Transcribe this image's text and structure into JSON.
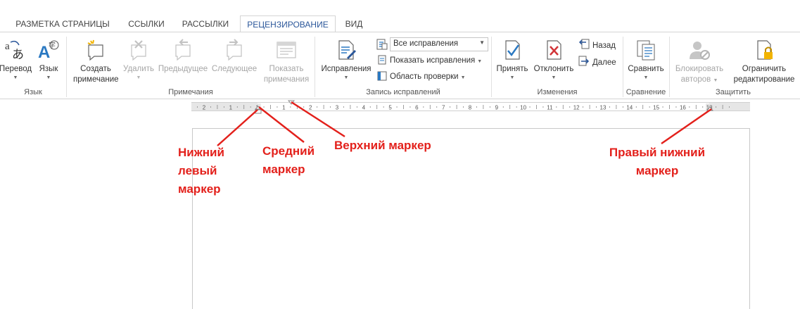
{
  "tabs": [
    {
      "label": "РАЗМЕТКА СТРАНИЦЫ",
      "active": false
    },
    {
      "label": "ССЫЛКИ",
      "active": false
    },
    {
      "label": "РАССЫЛКИ",
      "active": false
    },
    {
      "label": "РЕЦЕНЗИРОВАНИЕ",
      "active": true
    },
    {
      "label": "ВИД",
      "active": false
    }
  ],
  "ribbon": {
    "language": {
      "group_label": "Язык",
      "translate": "Перевод",
      "language": "Язык"
    },
    "comments": {
      "group_label": "Примечания",
      "create_line1": "Создать",
      "create_line2": "примечание",
      "delete": "Удалить",
      "previous": "Предыдущее",
      "next": "Следующее",
      "show_line1": "Показать",
      "show_line2": "примечания"
    },
    "tracking": {
      "group_label": "Запись исправлений",
      "track_changes": "Исправления",
      "display_select": "Все исправления",
      "show_markup": "Показать исправления",
      "reviewing_pane": "Область проверки"
    },
    "changes": {
      "group_label": "Изменения",
      "accept": "Принять",
      "reject": "Отклонить",
      "previous": "Назад",
      "next": "Далее"
    },
    "compare": {
      "group_label": "Сравнение",
      "compare": "Сравнить"
    },
    "protect": {
      "group_label": "Защитить",
      "block_line1": "Блокировать",
      "block_line2": "авторов",
      "restrict_line1": "Ограничить",
      "restrict_line2": "редактирование"
    }
  },
  "ruler": {
    "labels": [
      "2",
      "1",
      "1",
      "1",
      "2",
      "3",
      "4",
      "5",
      "6",
      "7",
      "8",
      "9",
      "10",
      "11",
      "12",
      "13",
      "14",
      "15",
      "16",
      "18"
    ]
  },
  "annotations": {
    "bottom_left": [
      "Нижний",
      "левый",
      "маркер"
    ],
    "middle": [
      "Средний",
      "маркер"
    ],
    "top": "Верхний маркер",
    "bottom_right": [
      "Правый нижний",
      "маркер"
    ]
  },
  "colors": {
    "annotation": "#e3201b",
    "accent_tab": "#2b579a",
    "ribbon_border": "#d4d4d4"
  }
}
